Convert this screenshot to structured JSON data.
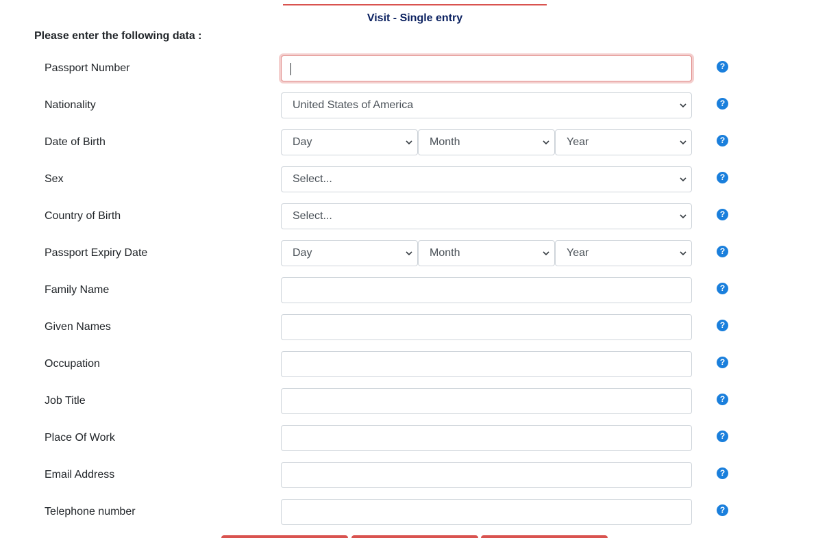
{
  "form": {
    "title": "Visit - Single entry",
    "instructions": "Please enter the following data :",
    "help_glyph": "?",
    "accent_color": "#d9534f",
    "title_color": "#0b2160",
    "help_color": "#1a7fdc"
  },
  "fields": {
    "passport_number": {
      "label": "Passport Number",
      "value": ""
    },
    "nationality": {
      "label": "Nationality",
      "selected": "United States of America"
    },
    "date_of_birth": {
      "label": "Date of Birth",
      "day": "Day",
      "month": "Month",
      "year": "Year"
    },
    "sex": {
      "label": "Sex",
      "selected": "Select..."
    },
    "country_of_birth": {
      "label": "Country of Birth",
      "selected": "Select..."
    },
    "passport_expiry": {
      "label": "Passport Expiry Date",
      "day": "Day",
      "month": "Month",
      "year": "Year"
    },
    "family_name": {
      "label": "Family Name",
      "value": ""
    },
    "given_names": {
      "label": "Given Names",
      "value": ""
    },
    "occupation": {
      "label": "Occupation",
      "value": ""
    },
    "job_title": {
      "label": "Job Title",
      "value": ""
    },
    "place_of_work": {
      "label": "Place Of Work",
      "value": ""
    },
    "email_address": {
      "label": "Email Address",
      "value": ""
    },
    "telephone_number": {
      "label": "Telephone number",
      "value": ""
    }
  },
  "icons": {
    "help": "question-circle-icon",
    "dropdown": "chevron-down-icon"
  }
}
